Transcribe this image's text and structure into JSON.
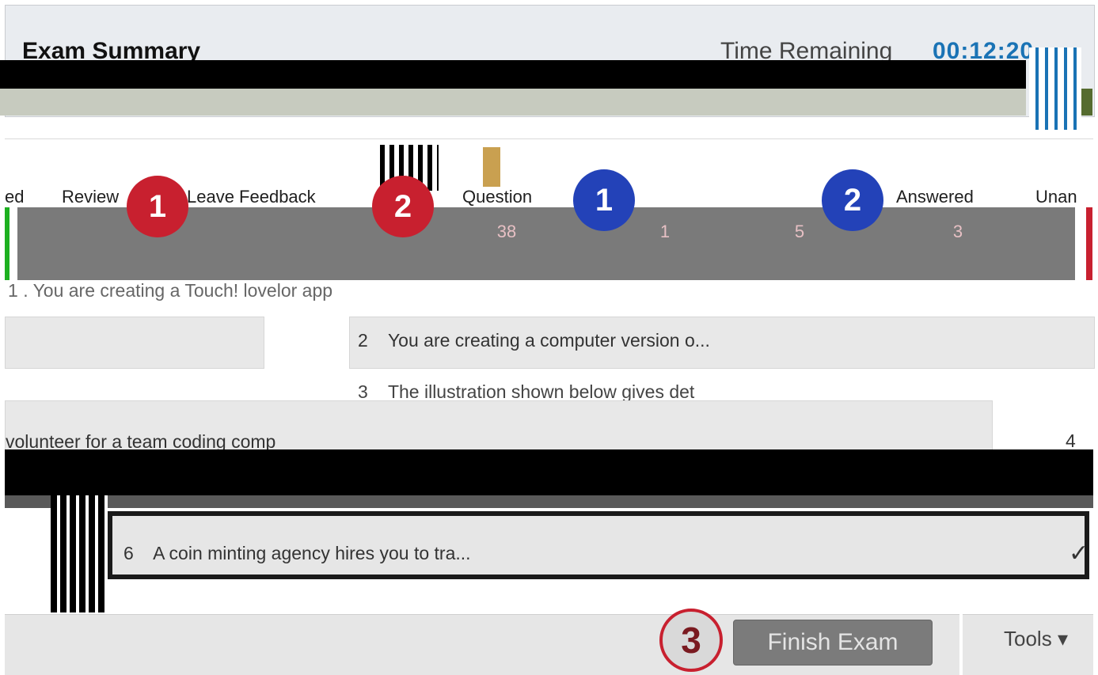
{
  "header": {
    "title": "Exam Summary",
    "timer_label": "Time Remaining",
    "timer_value": "00:12:20"
  },
  "toolbar": {
    "review_label": "Review",
    "feedback_label": "Leave Feedback",
    "question_label": "Question",
    "answered_label": "Answered",
    "unanswered_label": "Unan",
    "marked_label": "ed",
    "badges": [
      "1",
      "2",
      "1",
      "2"
    ]
  },
  "stats": {
    "question_total": "38",
    "v1": "1",
    "v2": "5",
    "v3": "3"
  },
  "questions": [
    {
      "num": "1",
      "text": "You are creating a Touch! lovelor app"
    },
    {
      "num": "2",
      "text": "You are creating a computer version o..."
    },
    {
      "num": "3",
      "text": "The illustration shown below gives det"
    },
    {
      "num": "4",
      "text": "volunteer for a team coding comp"
    },
    {
      "num": "6",
      "text": "A coin minting agency hires you to tra..."
    }
  ],
  "footer": {
    "step_number": "3",
    "finish_label": "Finish Exam",
    "tools_label": "Tools"
  },
  "colors": {
    "accent_blue": "#1a73b5",
    "badge_red": "#c8202f",
    "badge_blue": "#2342b8"
  }
}
